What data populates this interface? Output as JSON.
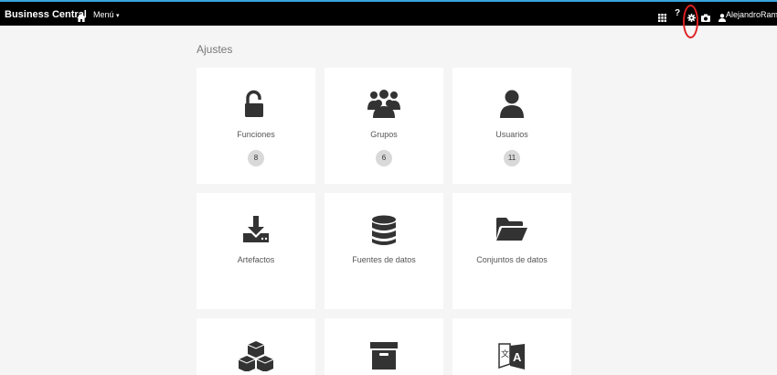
{
  "navbar": {
    "brand": "Business Central",
    "menu_label": "Menú",
    "help_label": "?",
    "user_name": "AlejandroRamos",
    "accent_color": "#39a5dc",
    "icons": [
      "home-icon",
      "grid-icon",
      "help-icon",
      "gear-icon",
      "camera-icon",
      "user-icon"
    ]
  },
  "page": {
    "title": "Ajustes"
  },
  "cards": [
    {
      "label": "Funciones",
      "count": "8",
      "icon": "unlock-icon"
    },
    {
      "label": "Grupos",
      "count": "6",
      "icon": "users-icon"
    },
    {
      "label": "Usuarios",
      "count": "11",
      "icon": "user-icon"
    },
    {
      "label": "Artefactos",
      "icon": "download-icon"
    },
    {
      "label": "Fuentes de datos",
      "icon": "database-icon"
    },
    {
      "label": "Conjuntos de datos",
      "icon": "folder-open-icon"
    },
    {
      "icon": "cubes-icon"
    },
    {
      "icon": "archive-icon"
    },
    {
      "icon": "language-icon"
    }
  ],
  "annotation": {
    "color": "#e02020",
    "target": "gear-icon"
  }
}
